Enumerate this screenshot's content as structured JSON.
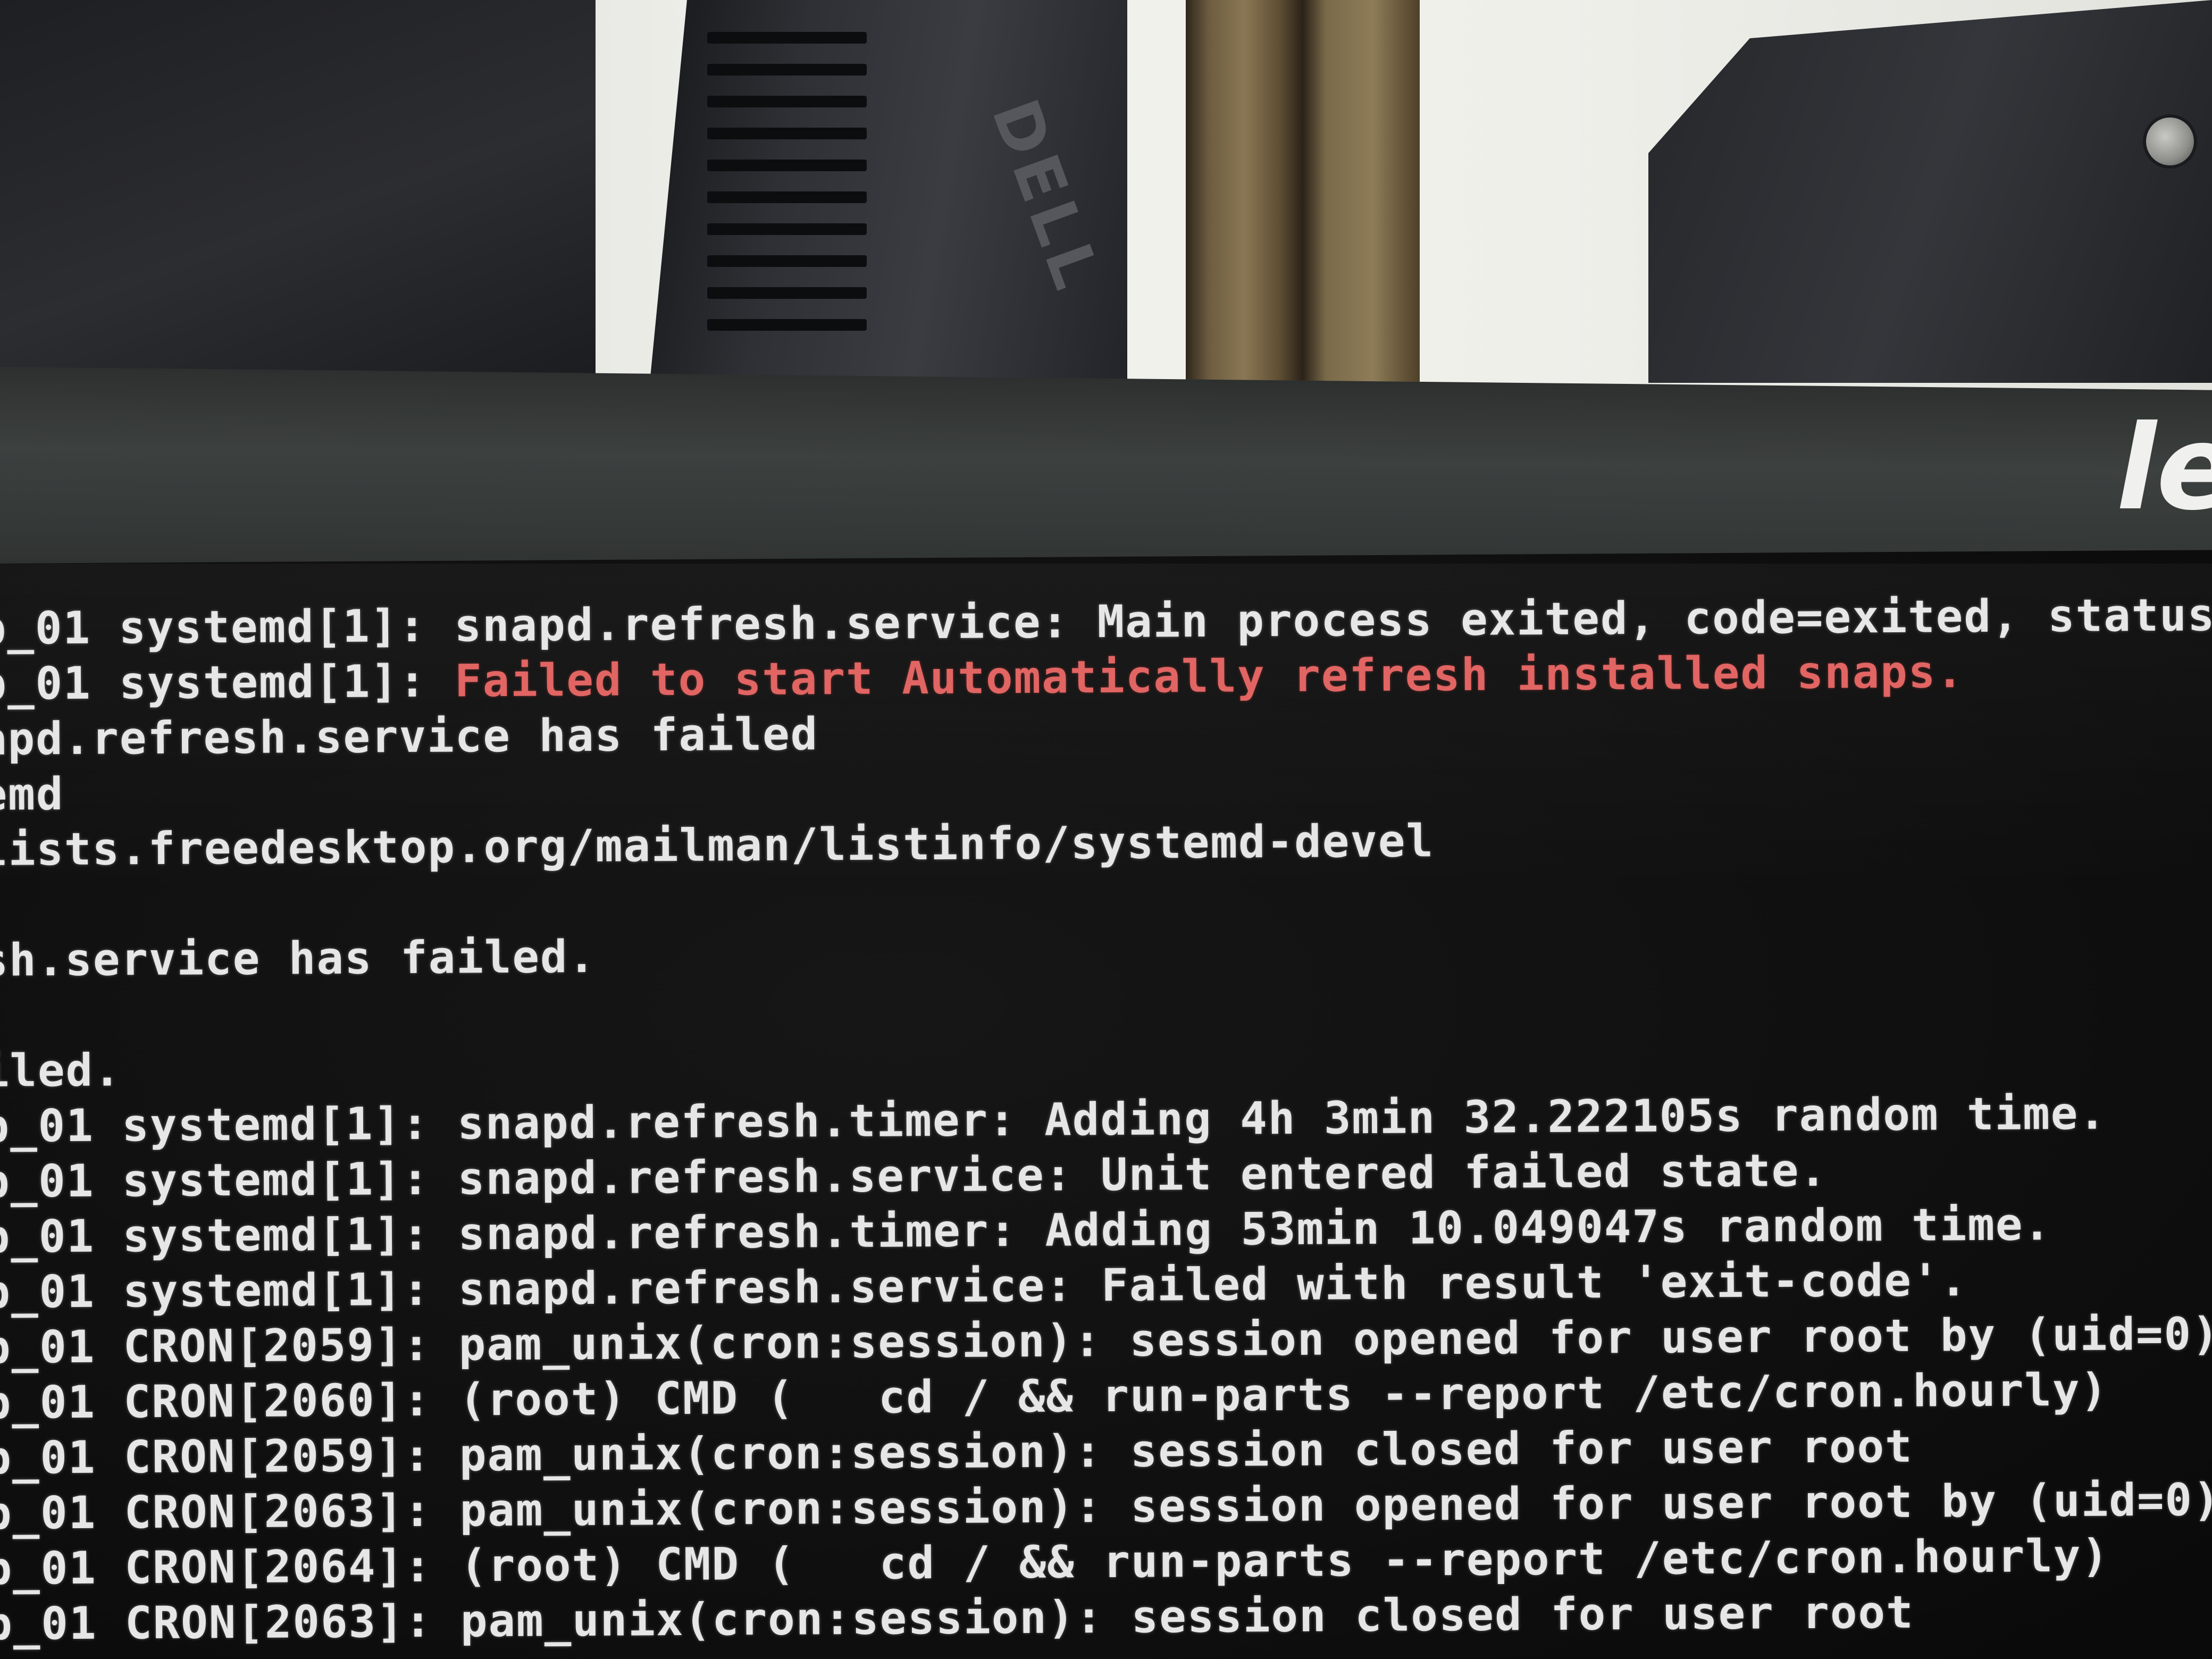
{
  "background": {
    "brand_logo": "le",
    "tower_logo": "DELL"
  },
  "console": {
    "lines": [
      {
        "prefix": "p_01 systemd[1]: ",
        "message": "snapd.refresh.service: Main process exited, code=exited, status=",
        "highlight": false
      },
      {
        "prefix": "p_01 systemd[1]: ",
        "message": "Failed to start Automatically refresh installed snaps.",
        "highlight": true
      },
      {
        "prefix": "",
        "message": "apd.refresh.service has failed",
        "highlight": false
      },
      {
        "prefix": "",
        "message": "emd",
        "highlight": false
      },
      {
        "prefix": "",
        "message": "lists.freedesktop.org/mailman/listinfo/systemd-devel",
        "highlight": false
      },
      {
        "prefix": "",
        "message": "",
        "highlight": false
      },
      {
        "prefix": "",
        "message": "sh.service has failed.",
        "highlight": false
      },
      {
        "prefix": "",
        "message": "",
        "highlight": false
      },
      {
        "prefix": "",
        "message": "iled.",
        "highlight": false
      },
      {
        "prefix": "p_01 systemd[1]: ",
        "message": "snapd.refresh.timer: Adding 4h 3min 32.222105s random time.",
        "highlight": false
      },
      {
        "prefix": "p_01 systemd[1]: ",
        "message": "snapd.refresh.service: Unit entered failed state.",
        "highlight": false
      },
      {
        "prefix": "p_01 systemd[1]: ",
        "message": "snapd.refresh.timer: Adding 53min 10.049047s random time.",
        "highlight": false
      },
      {
        "prefix": "p_01 systemd[1]: ",
        "message": "snapd.refresh.service: Failed with result 'exit-code'.",
        "highlight": false
      },
      {
        "prefix": "p_01 CRON[2059]: ",
        "message": "pam_unix(cron:session): session opened for user root by (uid=0)",
        "highlight": false
      },
      {
        "prefix": "p_01 CRON[2060]: ",
        "message": "(root) CMD (   cd / && run-parts --report /etc/cron.hourly)",
        "highlight": false
      },
      {
        "prefix": "p_01 CRON[2059]: ",
        "message": "pam_unix(cron:session): session closed for user root",
        "highlight": false
      },
      {
        "prefix": "p_01 CRON[2063]: ",
        "message": "pam_unix(cron:session): session opened for user root by (uid=0)",
        "highlight": false
      },
      {
        "prefix": "p_01 CRON[2064]: ",
        "message": "(root) CMD (   cd / && run-parts --report /etc/cron.hourly)",
        "highlight": false
      },
      {
        "prefix": "p_01 CRON[2063]: ",
        "message": "pam_unix(cron:session): session closed for user root",
        "highlight": false
      }
    ]
  },
  "colors": {
    "text": "#e6e6e6",
    "error": "#e0615f",
    "screen": "#0f0f0f"
  }
}
